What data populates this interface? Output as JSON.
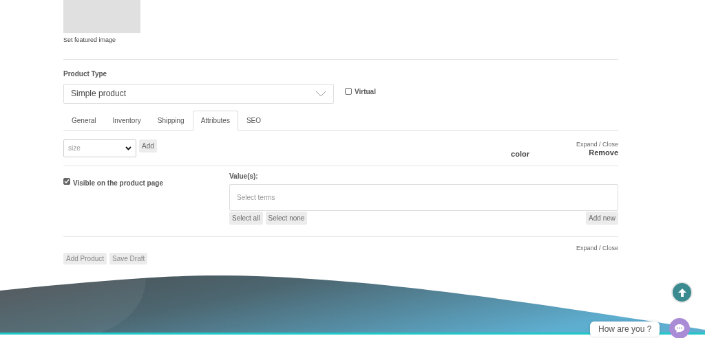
{
  "featured_image": {
    "label": "Set featured image"
  },
  "product_type": {
    "label": "Product Type",
    "value": "Simple product"
  },
  "virtual": {
    "label": "Virtual",
    "checked": false
  },
  "tabs": [
    {
      "label": "General",
      "selected": false
    },
    {
      "label": "Inventory",
      "selected": false
    },
    {
      "label": "Shipping",
      "selected": false
    },
    {
      "label": "Attributes",
      "selected": true
    },
    {
      "label": "SEO",
      "selected": false
    }
  ],
  "attribute_picker": {
    "value": "size",
    "button": "Add"
  },
  "attribute": {
    "name": "color",
    "expand": "Expand / Close",
    "remove": "Remove",
    "visible": {
      "label": "Visible on the product page",
      "checked": true
    },
    "values_label": "Value(s):",
    "placeholder": "Select terms",
    "buttons": [
      "Select all",
      "Select none"
    ],
    "add_new": "Add new"
  },
  "section_expand": "Expand / Close",
  "actions": [
    "Add Product",
    "Save Draft"
  ],
  "chat": {
    "text": "How are you ?"
  }
}
